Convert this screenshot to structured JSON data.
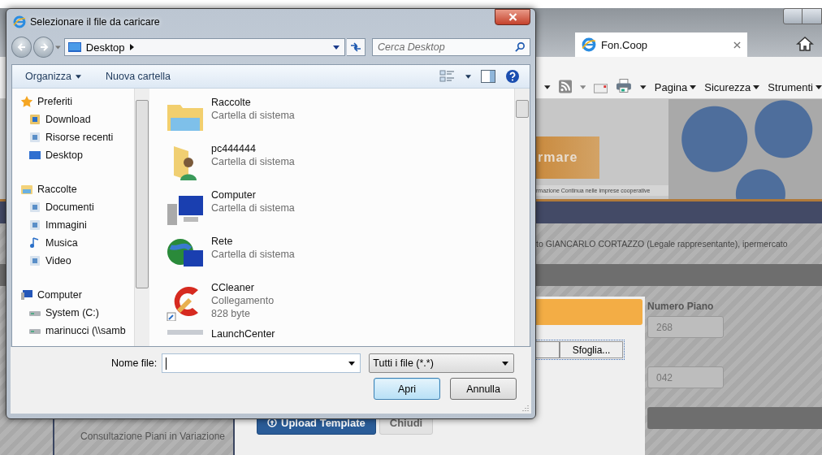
{
  "browser": {
    "tab": {
      "title": "Fon.Coop"
    },
    "command_bar": [
      {
        "label": "Pagina"
      },
      {
        "label": "Sicurezza"
      },
      {
        "label": "Strumenti"
      }
    ]
  },
  "page": {
    "banner": {
      "title": "rmare",
      "subtitle": "rmazione Continua nelle imprese cooperative"
    },
    "user_line": "to GIANCARLO CORTAZZO (Legale rappresentante), ipermercato",
    "sidebar": {
      "items": [
        "Consultazione Piani in Variazione"
      ]
    },
    "upload_panel": {
      "browse_button": "Sfoglia...",
      "buttons": [
        {
          "label": "Upload Template",
          "kind": "primary"
        },
        {
          "label": "Chiudi",
          "kind": "secondary"
        }
      ]
    },
    "fields": [
      {
        "label": "Numero Piano",
        "value": "268"
      },
      {
        "value": "042"
      }
    ]
  },
  "dialog": {
    "title": "Selezionare il file da caricare",
    "address": "Desktop",
    "search": {
      "placeholder": "Cerca Desktop"
    },
    "toolbar": [
      {
        "label": "Organizza",
        "dropdown": true
      },
      {
        "label": "Nuova cartella",
        "dropdown": false
      }
    ],
    "nav": [
      {
        "label": "Preferiti",
        "kind": "star",
        "children": [
          {
            "label": "Download",
            "kind": "download"
          },
          {
            "label": "Risorse recenti",
            "kind": "recent"
          },
          {
            "label": "Desktop",
            "kind": "desktop"
          }
        ]
      },
      {
        "label": "Raccolte",
        "kind": "library",
        "children": [
          {
            "label": "Documenti",
            "kind": "documents"
          },
          {
            "label": "Immagini",
            "kind": "pictures"
          },
          {
            "label": "Musica",
            "kind": "music"
          },
          {
            "label": "Video",
            "kind": "video"
          }
        ]
      },
      {
        "label": "Computer",
        "kind": "computer",
        "children": [
          {
            "label": "System (C:)",
            "kind": "drive"
          },
          {
            "label": "marinucci (\\\\samb",
            "kind": "netdrive"
          }
        ]
      }
    ],
    "files": [
      {
        "name": "Raccolte",
        "type": "Cartella di sistema",
        "kind": "library"
      },
      {
        "name": "pc444444",
        "type": "Cartella di sistema",
        "kind": "user"
      },
      {
        "name": "Computer",
        "type": "Cartella di sistema",
        "kind": "computer"
      },
      {
        "name": "Rete",
        "type": "Cartella di sistema",
        "kind": "network"
      },
      {
        "name": "CCleaner",
        "type": "Collegamento",
        "size": "828 byte",
        "kind": "shortcut"
      },
      {
        "name": "LaunchCenter",
        "kind": "app"
      }
    ],
    "filename_label": "Nome file:",
    "file_type": "Tutti i file (*.*)",
    "buttons": [
      {
        "label": "Apri",
        "kind": "default"
      },
      {
        "label": "Annulla",
        "kind": "normal"
      }
    ]
  }
}
